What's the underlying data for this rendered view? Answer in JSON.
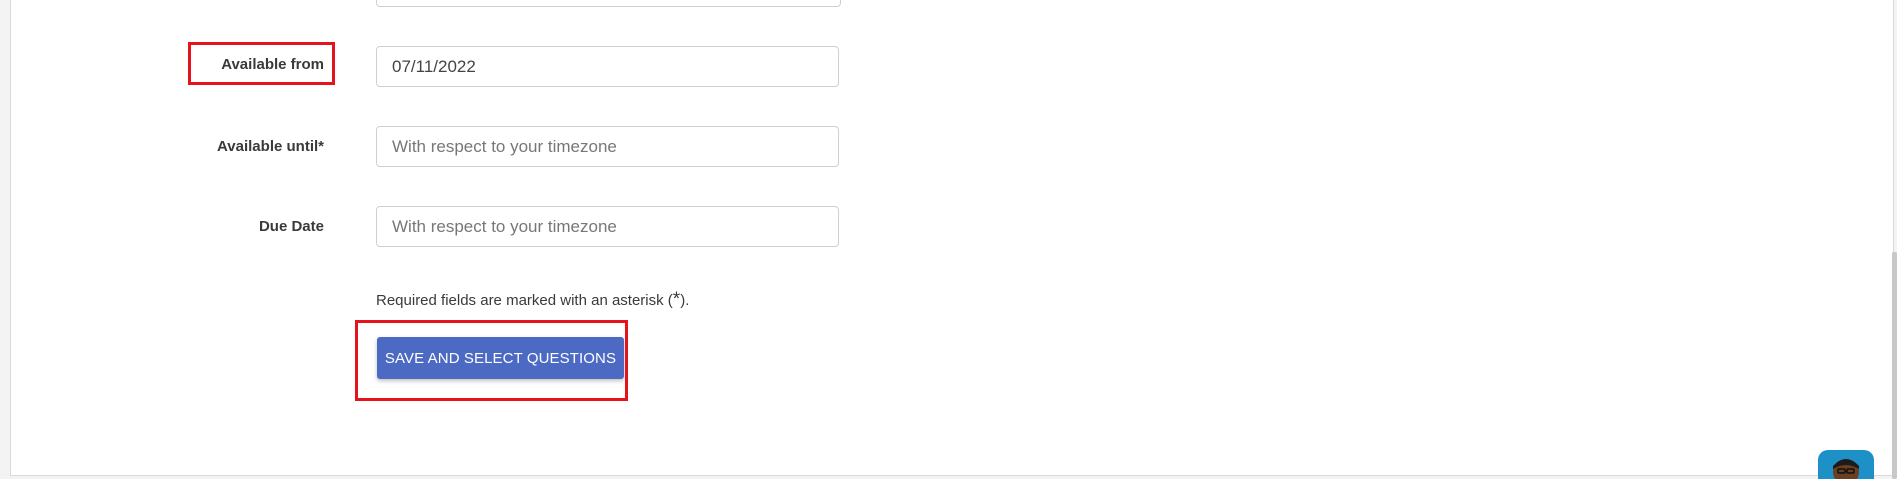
{
  "form": {
    "available_from": {
      "label": "Available from",
      "value": "07/11/2022"
    },
    "available_until": {
      "label": "Available until*",
      "placeholder": "With respect to your timezone"
    },
    "due_date": {
      "label": "Due Date",
      "placeholder": "With respect to your timezone"
    },
    "hint": {
      "text": "Required fields are marked with an asterisk (",
      "asterisk": "*",
      "end": ")."
    },
    "save_button": {
      "label": "SAVE AND SELECT QUESTIONS"
    }
  },
  "colors": {
    "primary_button": "#4c6ac3",
    "highlight": "#e8121c",
    "chat_widget": "#1e90c8"
  },
  "icons": {
    "chat_widget": "support-avatar-icon"
  }
}
